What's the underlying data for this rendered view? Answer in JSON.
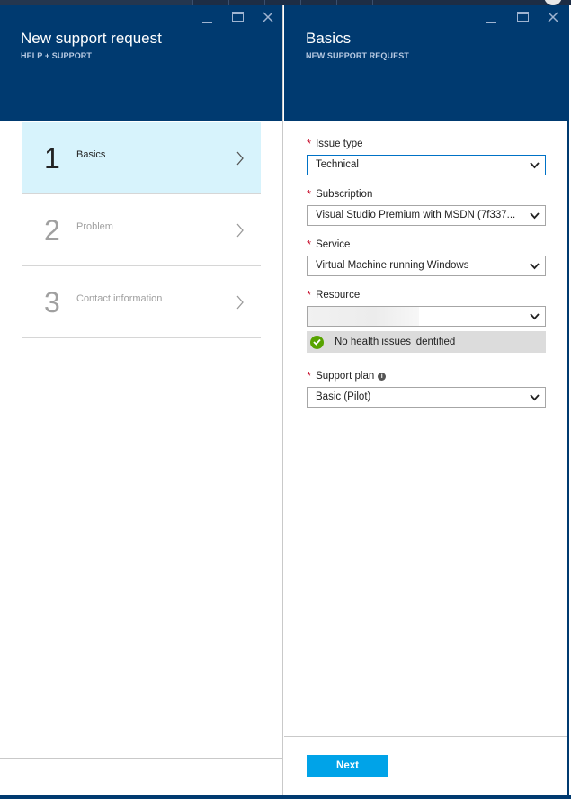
{
  "left_blade": {
    "title": "New support request",
    "subtitle": "HELP + SUPPORT",
    "steps": [
      {
        "number": "1",
        "label": "Basics",
        "active": true
      },
      {
        "number": "2",
        "label": "Problem",
        "active": false
      },
      {
        "number": "3",
        "label": "Contact information",
        "active": false
      }
    ]
  },
  "right_blade": {
    "title": "Basics",
    "subtitle": "NEW SUPPORT REQUEST",
    "fields": {
      "issue_type": {
        "label": "Issue type",
        "value": "Technical"
      },
      "subscription": {
        "label": "Subscription",
        "value": "Visual Studio Premium with MSDN (7f337..."
      },
      "service": {
        "label": "Service",
        "value": "Virtual Machine running Windows"
      },
      "resource": {
        "label": "Resource",
        "value": ""
      },
      "support_plan": {
        "label": "Support plan",
        "value": "Basic (Pilot)"
      }
    },
    "health_message": "No health issues identified",
    "required_marker": "*",
    "next_label": "Next"
  },
  "colors": {
    "header": "#003a70",
    "active_step": "#d7f3fc",
    "accent_button": "#00a3e8",
    "required": "#c8102e",
    "health_ok": "#57a300"
  },
  "icons": {
    "minimize": "minimize-icon",
    "maximize": "maximize-icon",
    "close": "close-icon",
    "chevron_right": "chevron-right-icon",
    "chevron_down": "chevron-down-icon",
    "info": "info-icon",
    "check": "check-icon"
  }
}
